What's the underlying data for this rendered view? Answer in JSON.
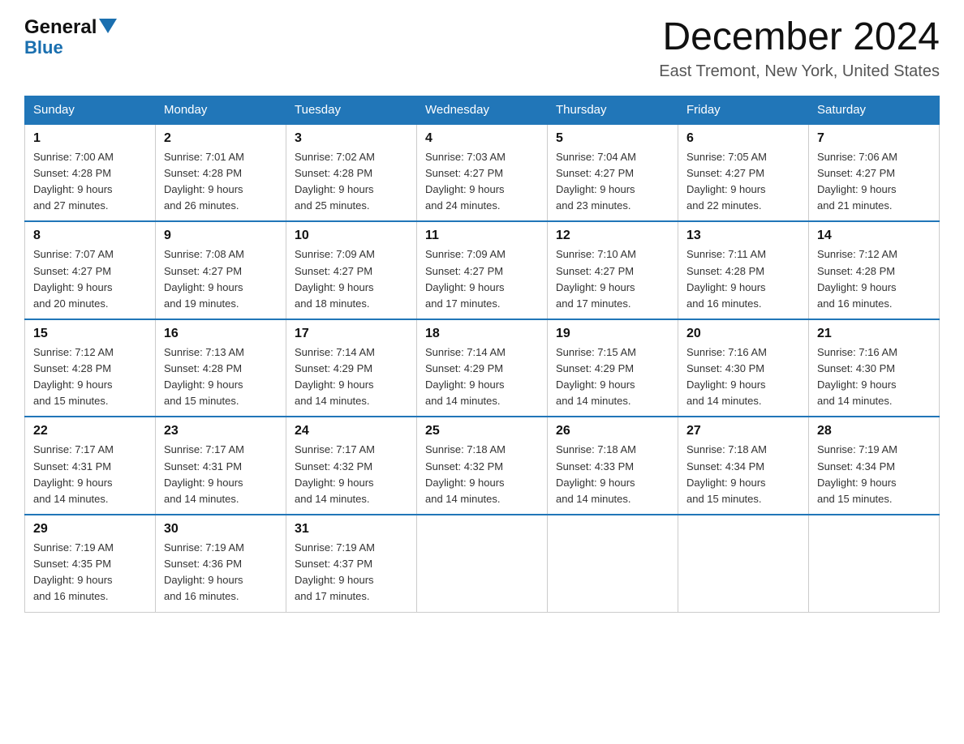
{
  "header": {
    "month_year": "December 2024",
    "location": "East Tremont, New York, United States",
    "logo_general": "General",
    "logo_blue": "Blue"
  },
  "columns": [
    "Sunday",
    "Monday",
    "Tuesday",
    "Wednesday",
    "Thursday",
    "Friday",
    "Saturday"
  ],
  "weeks": [
    [
      {
        "day": "1",
        "sunrise": "7:00 AM",
        "sunset": "4:28 PM",
        "daylight": "9 hours and 27 minutes."
      },
      {
        "day": "2",
        "sunrise": "7:01 AM",
        "sunset": "4:28 PM",
        "daylight": "9 hours and 26 minutes."
      },
      {
        "day": "3",
        "sunrise": "7:02 AM",
        "sunset": "4:28 PM",
        "daylight": "9 hours and 25 minutes."
      },
      {
        "day": "4",
        "sunrise": "7:03 AM",
        "sunset": "4:27 PM",
        "daylight": "9 hours and 24 minutes."
      },
      {
        "day": "5",
        "sunrise": "7:04 AM",
        "sunset": "4:27 PM",
        "daylight": "9 hours and 23 minutes."
      },
      {
        "day": "6",
        "sunrise": "7:05 AM",
        "sunset": "4:27 PM",
        "daylight": "9 hours and 22 minutes."
      },
      {
        "day": "7",
        "sunrise": "7:06 AM",
        "sunset": "4:27 PM",
        "daylight": "9 hours and 21 minutes."
      }
    ],
    [
      {
        "day": "8",
        "sunrise": "7:07 AM",
        "sunset": "4:27 PM",
        "daylight": "9 hours and 20 minutes."
      },
      {
        "day": "9",
        "sunrise": "7:08 AM",
        "sunset": "4:27 PM",
        "daylight": "9 hours and 19 minutes."
      },
      {
        "day": "10",
        "sunrise": "7:09 AM",
        "sunset": "4:27 PM",
        "daylight": "9 hours and 18 minutes."
      },
      {
        "day": "11",
        "sunrise": "7:09 AM",
        "sunset": "4:27 PM",
        "daylight": "9 hours and 17 minutes."
      },
      {
        "day": "12",
        "sunrise": "7:10 AM",
        "sunset": "4:27 PM",
        "daylight": "9 hours and 17 minutes."
      },
      {
        "day": "13",
        "sunrise": "7:11 AM",
        "sunset": "4:28 PM",
        "daylight": "9 hours and 16 minutes."
      },
      {
        "day": "14",
        "sunrise": "7:12 AM",
        "sunset": "4:28 PM",
        "daylight": "9 hours and 16 minutes."
      }
    ],
    [
      {
        "day": "15",
        "sunrise": "7:12 AM",
        "sunset": "4:28 PM",
        "daylight": "9 hours and 15 minutes."
      },
      {
        "day": "16",
        "sunrise": "7:13 AM",
        "sunset": "4:28 PM",
        "daylight": "9 hours and 15 minutes."
      },
      {
        "day": "17",
        "sunrise": "7:14 AM",
        "sunset": "4:29 PM",
        "daylight": "9 hours and 14 minutes."
      },
      {
        "day": "18",
        "sunrise": "7:14 AM",
        "sunset": "4:29 PM",
        "daylight": "9 hours and 14 minutes."
      },
      {
        "day": "19",
        "sunrise": "7:15 AM",
        "sunset": "4:29 PM",
        "daylight": "9 hours and 14 minutes."
      },
      {
        "day": "20",
        "sunrise": "7:16 AM",
        "sunset": "4:30 PM",
        "daylight": "9 hours and 14 minutes."
      },
      {
        "day": "21",
        "sunrise": "7:16 AM",
        "sunset": "4:30 PM",
        "daylight": "9 hours and 14 minutes."
      }
    ],
    [
      {
        "day": "22",
        "sunrise": "7:17 AM",
        "sunset": "4:31 PM",
        "daylight": "9 hours and 14 minutes."
      },
      {
        "day": "23",
        "sunrise": "7:17 AM",
        "sunset": "4:31 PM",
        "daylight": "9 hours and 14 minutes."
      },
      {
        "day": "24",
        "sunrise": "7:17 AM",
        "sunset": "4:32 PM",
        "daylight": "9 hours and 14 minutes."
      },
      {
        "day": "25",
        "sunrise": "7:18 AM",
        "sunset": "4:32 PM",
        "daylight": "9 hours and 14 minutes."
      },
      {
        "day": "26",
        "sunrise": "7:18 AM",
        "sunset": "4:33 PM",
        "daylight": "9 hours and 14 minutes."
      },
      {
        "day": "27",
        "sunrise": "7:18 AM",
        "sunset": "4:34 PM",
        "daylight": "9 hours and 15 minutes."
      },
      {
        "day": "28",
        "sunrise": "7:19 AM",
        "sunset": "4:34 PM",
        "daylight": "9 hours and 15 minutes."
      }
    ],
    [
      {
        "day": "29",
        "sunrise": "7:19 AM",
        "sunset": "4:35 PM",
        "daylight": "9 hours and 16 minutes."
      },
      {
        "day": "30",
        "sunrise": "7:19 AM",
        "sunset": "4:36 PM",
        "daylight": "9 hours and 16 minutes."
      },
      {
        "day": "31",
        "sunrise": "7:19 AM",
        "sunset": "4:37 PM",
        "daylight": "9 hours and 17 minutes."
      },
      null,
      null,
      null,
      null
    ]
  ],
  "labels": {
    "sunrise": "Sunrise:",
    "sunset": "Sunset:",
    "daylight": "Daylight:"
  }
}
